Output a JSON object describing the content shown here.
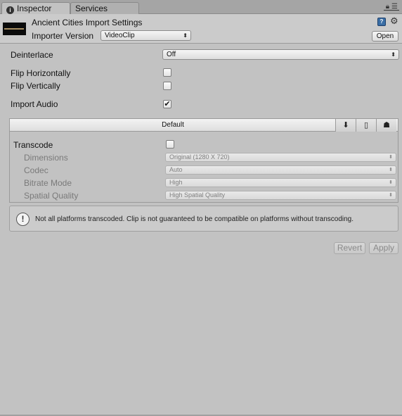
{
  "tabs": [
    {
      "label": "Inspector",
      "icon": "info-icon"
    },
    {
      "label": "Services"
    }
  ],
  "header": {
    "title": "Ancient Cities Import Settings",
    "importer_version_label": "Importer Version",
    "importer_version_value": "VideoClip",
    "open_button": "Open"
  },
  "properties": {
    "deinterlace": {
      "label": "Deinterlace",
      "value": "Off"
    },
    "flip_horizontally": {
      "label": "Flip Horizontally",
      "checked": false
    },
    "flip_vertically": {
      "label": "Flip Vertically",
      "checked": false
    },
    "import_audio": {
      "label": "Import Audio",
      "checked": true,
      "mark": "✔"
    }
  },
  "platform_panel": {
    "default_tab": "Default",
    "platform_icons": [
      "download-icon",
      "ios-device-icon",
      "android-icon"
    ],
    "transcode": {
      "label": "Transcode",
      "checked": false
    },
    "dimensions": {
      "label": "Dimensions",
      "value": "Original (1280 X 720)"
    },
    "codec": {
      "label": "Codec",
      "value": "Auto"
    },
    "bitrate_mode": {
      "label": "Bitrate Mode",
      "value": "High"
    },
    "spatial_quality": {
      "label": "Spatial Quality",
      "value": "High Spatial Quality"
    }
  },
  "help": {
    "icon": "warning-icon",
    "text": "Not all platforms transcoded. Clip is not guaranteed to be compatible on platforms without transcoding."
  },
  "buttons": {
    "revert": "Revert",
    "apply": "Apply"
  }
}
